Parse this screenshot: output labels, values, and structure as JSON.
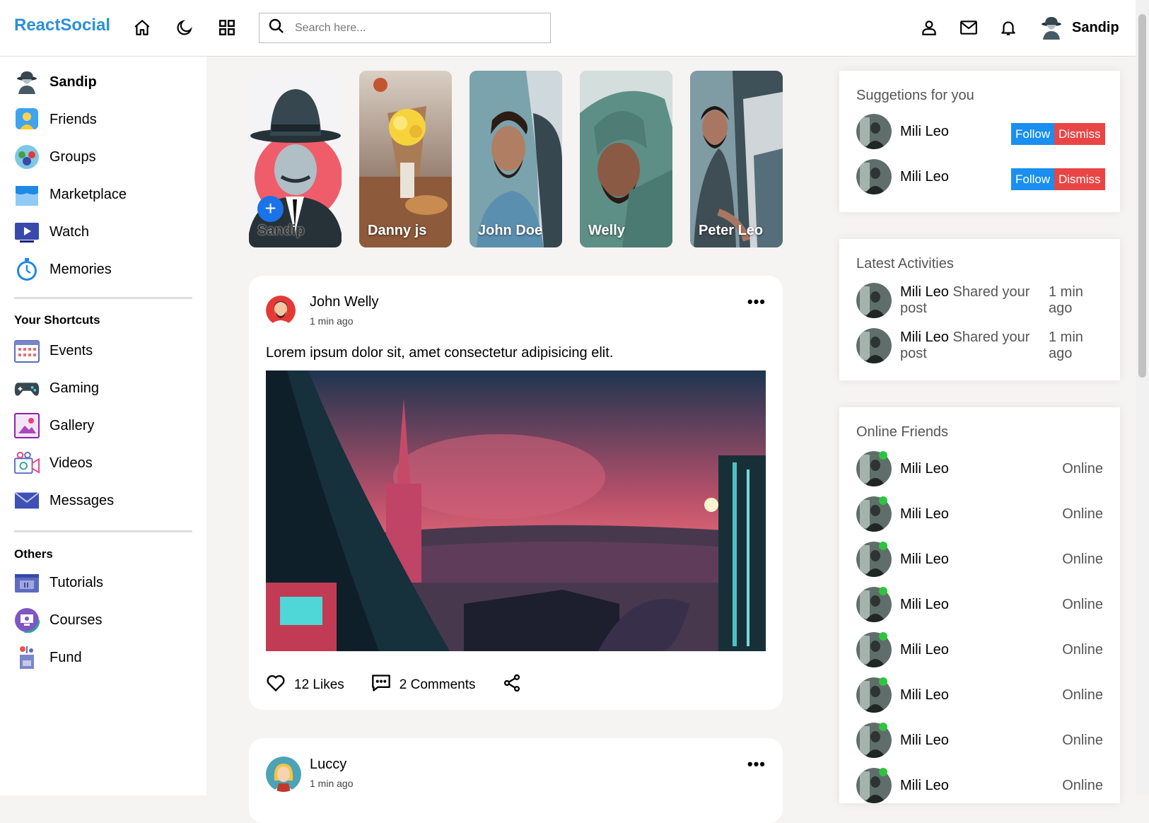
{
  "navbar": {
    "logo": "ReactSocial",
    "search_placeholder": "Search here...",
    "user_name": "Sandip"
  },
  "leftbar": {
    "user_name": "Sandip",
    "main_items": [
      {
        "label": "Friends",
        "icon": "friends-icon"
      },
      {
        "label": "Groups",
        "icon": "groups-icon"
      },
      {
        "label": "Marketplace",
        "icon": "marketplace-icon"
      },
      {
        "label": "Watch",
        "icon": "watch-icon"
      },
      {
        "label": "Memories",
        "icon": "memories-icon"
      }
    ],
    "shortcuts_heading": "Your Shortcuts",
    "shortcuts": [
      {
        "label": "Events",
        "icon": "events-icon"
      },
      {
        "label": "Gaming",
        "icon": "gaming-icon"
      },
      {
        "label": "Gallery",
        "icon": "gallery-icon"
      },
      {
        "label": "Videos",
        "icon": "videos-icon"
      },
      {
        "label": "Messages",
        "icon": "messages-icon"
      }
    ],
    "others_heading": "Others",
    "others": [
      {
        "label": "Tutorials",
        "icon": "tutorials-icon"
      },
      {
        "label": "Courses",
        "icon": "courses-icon"
      },
      {
        "label": "Fund",
        "icon": "fund-icon"
      }
    ]
  },
  "stories": [
    {
      "name": "Sandip",
      "own": true
    },
    {
      "name": "Danny js"
    },
    {
      "name": "John Doe"
    },
    {
      "name": "Welly"
    },
    {
      "name": "Peter Leo"
    }
  ],
  "posts": [
    {
      "author": "John Welly",
      "time": "1 min ago",
      "text": "Lorem ipsum dolor sit, amet consectetur adipisicing elit.",
      "likes": "12 Likes",
      "comments": "2 Comments"
    },
    {
      "author": "Luccy",
      "time": "1 min ago"
    }
  ],
  "suggestions": {
    "title": "Suggetions for you",
    "items": [
      {
        "name": "Mili Leo",
        "follow": "Follow",
        "dismiss": "Dismiss"
      },
      {
        "name": "Mili Leo",
        "follow": "Follow",
        "dismiss": "Dismiss"
      }
    ]
  },
  "activities": {
    "title": "Latest Activities",
    "items": [
      {
        "name": "Mili Leo",
        "action": "Shared your post",
        "time": "1 min ago"
      },
      {
        "name": "Mili Leo",
        "action": "Shared your post",
        "time": "1 min ago"
      }
    ]
  },
  "online": {
    "title": "Online Friends",
    "items": [
      {
        "name": "Mili Leo",
        "status": "Online"
      },
      {
        "name": "Mili Leo",
        "status": "Online"
      },
      {
        "name": "Mili Leo",
        "status": "Online"
      },
      {
        "name": "Mili Leo",
        "status": "Online"
      },
      {
        "name": "Mili Leo",
        "status": "Online"
      },
      {
        "name": "Mili Leo",
        "status": "Online"
      },
      {
        "name": "Mili Leo",
        "status": "Online"
      },
      {
        "name": "Mili Leo",
        "status": "Online"
      }
    ]
  },
  "colors": {
    "brand": "#2d8fd8",
    "follow": "#1a8fef",
    "dismiss": "#e94545",
    "online_dot": "#2ec440"
  }
}
